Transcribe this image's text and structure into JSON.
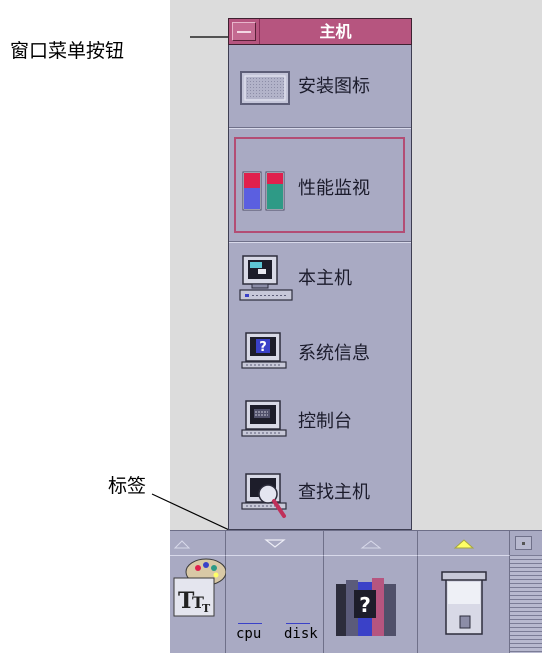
{
  "callouts": {
    "window_menu_button": "窗口菜单按钮",
    "label_tag": "标签"
  },
  "window": {
    "title": "主机"
  },
  "panel": {
    "items": [
      {
        "label": "安装图标",
        "icon": "install-icon-drop-target"
      },
      {
        "label": "性能监视",
        "icon": "performance-bars-icon"
      },
      {
        "label": "本主机",
        "icon": "this-host-computer-icon"
      },
      {
        "label": "系统信息",
        "icon": "system-info-question-monitor-icon"
      },
      {
        "label": "控制台",
        "icon": "console-terminal-icon"
      },
      {
        "label": "查找主机",
        "icon": "find-host-magnifier-icon"
      }
    ]
  },
  "dock": {
    "meter_labels": [
      "cpu",
      "disk"
    ],
    "colors": {
      "accent_yellow": "#ffff66",
      "title": "#b6557f",
      "panel": "#a9aac3"
    }
  }
}
